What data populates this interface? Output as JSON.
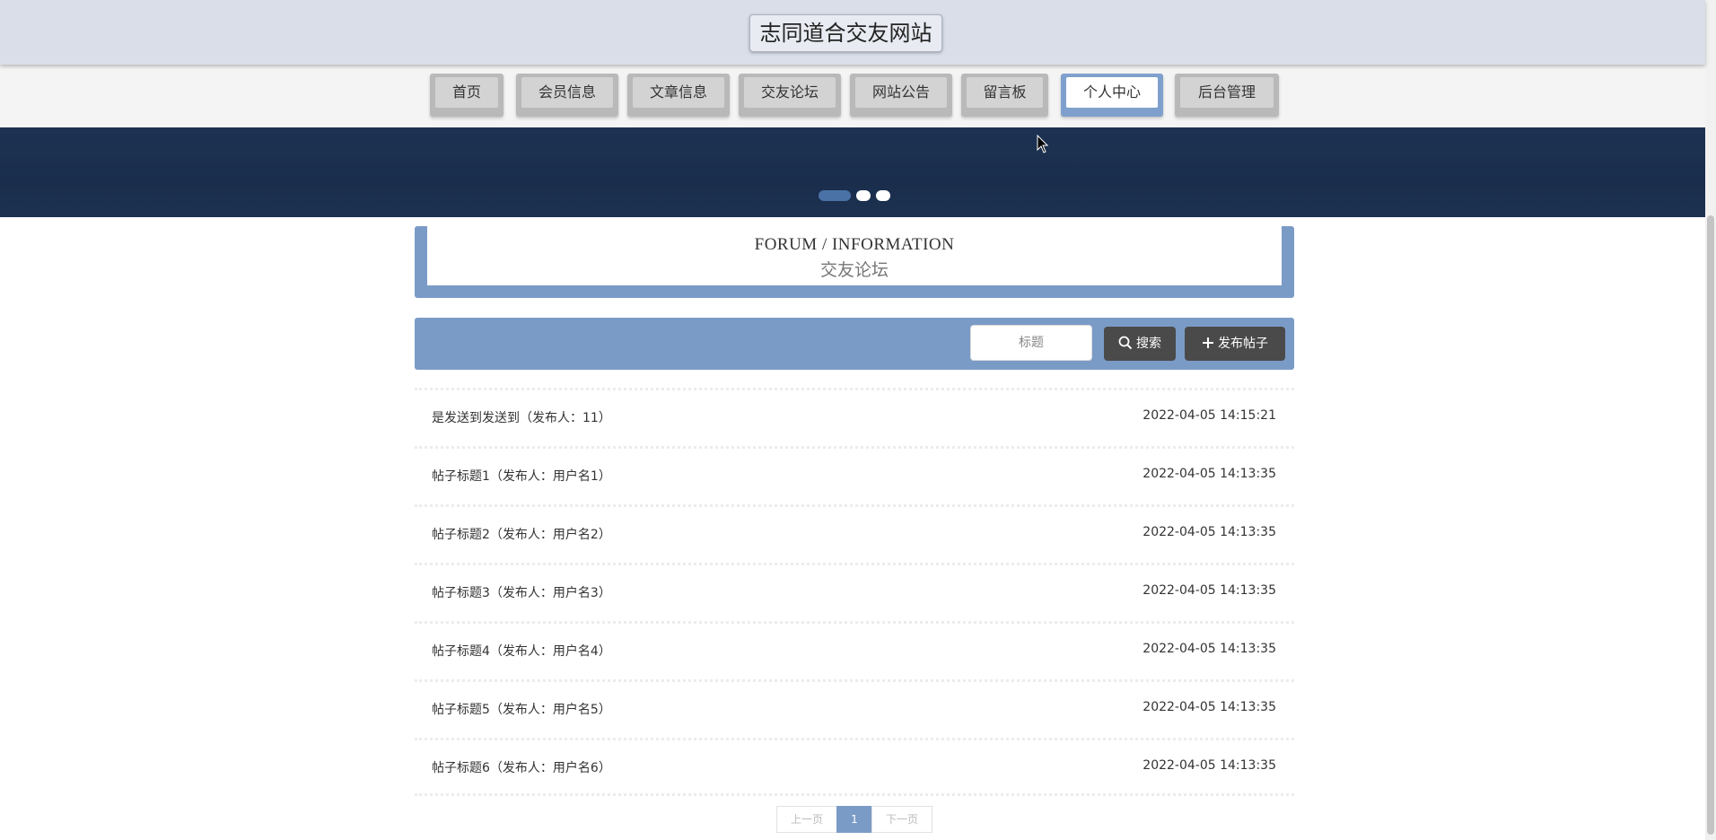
{
  "header": {
    "site_title": "志同道合交友网站"
  },
  "nav": {
    "items": [
      {
        "label": "首页"
      },
      {
        "label": "会员信息"
      },
      {
        "label": "文章信息"
      },
      {
        "label": "交友论坛"
      },
      {
        "label": "网站公告"
      },
      {
        "label": "留言板"
      },
      {
        "label": "个人中心",
        "active": true
      },
      {
        "label": "后台管理"
      }
    ]
  },
  "banner": {
    "slides": 3,
    "active_slide": 1
  },
  "section": {
    "title_en": "FORUM / INFORMATION",
    "title_zh": "交友论坛"
  },
  "search": {
    "placeholder": "标题",
    "search_label": "搜索",
    "publish_label": "发布帖子"
  },
  "posts": [
    {
      "title": "是发送到发送到（发布人：11）",
      "time": "2022-04-05 14:15:21"
    },
    {
      "title": "帖子标题1（发布人：用户名1）",
      "time": "2022-04-05 14:13:35"
    },
    {
      "title": "帖子标题2（发布人：用户名2）",
      "time": "2022-04-05 14:13:35"
    },
    {
      "title": "帖子标题3（发布人：用户名3）",
      "time": "2022-04-05 14:13:35"
    },
    {
      "title": "帖子标题4（发布人：用户名4）",
      "time": "2022-04-05 14:13:35"
    },
    {
      "title": "帖子标题5（发布人：用户名5）",
      "time": "2022-04-05 14:13:35"
    },
    {
      "title": "帖子标题6（发布人：用户名6）",
      "time": "2022-04-05 14:13:35"
    }
  ],
  "pagination": {
    "prev_label": "上一页",
    "current_page": "1",
    "next_label": "下一页"
  },
  "colors": {
    "accent": "#7b9bc7",
    "header_bg": "#d9dee9",
    "banner_bg": "#1d3253",
    "button_dark": "#4a4a4a"
  }
}
